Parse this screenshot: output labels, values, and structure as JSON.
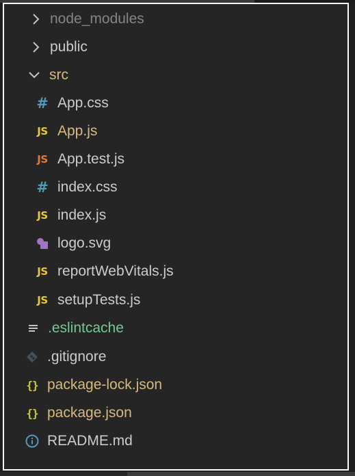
{
  "explorer": {
    "items": [
      {
        "label": "node_modules",
        "icon": "chevron-right-icon",
        "kind": "folder-collapsed"
      },
      {
        "label": "public",
        "icon": "chevron-right-icon",
        "kind": "folder-collapsed"
      },
      {
        "label": "src",
        "icon": "chevron-down-icon",
        "kind": "folder-expanded"
      },
      {
        "label": "App.css",
        "icon": "css-file-icon",
        "badge": "#"
      },
      {
        "label": "App.js",
        "icon": "js-file-icon",
        "badge": "JS"
      },
      {
        "label": "App.test.js",
        "icon": "js-test-file-icon",
        "badge": "JS"
      },
      {
        "label": "index.css",
        "icon": "css-file-icon",
        "badge": "#"
      },
      {
        "label": "index.js",
        "icon": "js-file-icon",
        "badge": "JS"
      },
      {
        "label": "logo.svg",
        "icon": "svg-file-icon"
      },
      {
        "label": "reportWebVitals.js",
        "icon": "js-file-icon",
        "badge": "JS"
      },
      {
        "label": "setupTests.js",
        "icon": "js-file-icon",
        "badge": "JS"
      },
      {
        "label": ".eslintcache",
        "icon": "lines-file-icon"
      },
      {
        "label": ".gitignore",
        "icon": "git-file-icon"
      },
      {
        "label": "package-lock.json",
        "icon": "json-file-icon",
        "badge": "{}"
      },
      {
        "label": "package.json",
        "icon": "json-file-icon",
        "badge": "{}"
      },
      {
        "label": "README.md",
        "icon": "info-file-icon"
      }
    ]
  },
  "colors": {
    "background": "#252526",
    "text": "#cccccc",
    "muted": "#858585",
    "modified_yellow": "#d7ba7d",
    "untracked_green": "#73c991",
    "js_badge": "#e8c73a",
    "test_badge": "#e37933",
    "css_badge": "#519aba",
    "json_badge": "#cbcb41",
    "svg_icon": "#a074c4",
    "info_icon": "#519aba"
  }
}
